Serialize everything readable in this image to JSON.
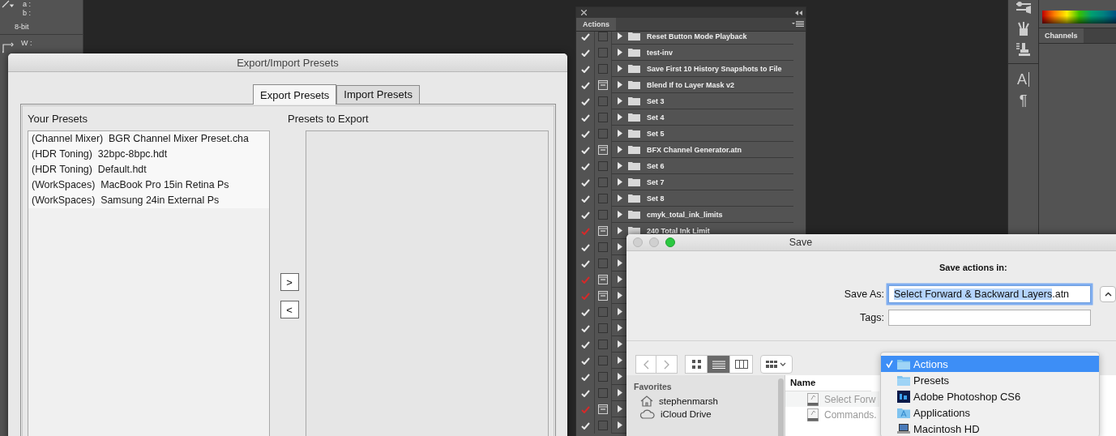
{
  "info_panel": {
    "channel_labels": [
      "a :",
      "b :"
    ],
    "bit_depth": "8-bit",
    "size_labels": [
      "W :"
    ]
  },
  "export_dialog": {
    "title": "Export/Import Presets",
    "tabs": [
      {
        "label": "Export Presets",
        "selected": true
      },
      {
        "label": "Import Presets",
        "selected": false
      }
    ],
    "your_presets": {
      "heading": "Your Presets",
      "items": [
        {
          "label": "(Channel Mixer)  BGR Channel Mixer Preset.cha"
        },
        {
          "label": "(HDR Toning)  32bpc-8bpc.hdt"
        },
        {
          "label": "(HDR Toning)  Default.hdt"
        },
        {
          "label": "(WorkSpaces)  MacBook Pro 15in Retina Ps"
        },
        {
          "label": "(WorkSpaces)  Samsung 24in External Ps"
        }
      ]
    },
    "presets_to_export": {
      "heading": "Presets to Export"
    },
    "buttons": [
      ">",
      "<"
    ]
  },
  "actions_panel": {
    "tab": "Actions",
    "rows": [
      {
        "name": "Reset Button Mode Playback",
        "checked": true,
        "partial": false,
        "dialog": false
      },
      {
        "name": "test-inv",
        "checked": true,
        "partial": false,
        "dialog": false
      },
      {
        "name": "Save First 10 History Snapshots to File",
        "checked": true,
        "partial": false,
        "dialog": false
      },
      {
        "name": "Blend If to Layer Mask v2",
        "checked": true,
        "partial": false,
        "dialog": true
      },
      {
        "name": "Set 3",
        "checked": true,
        "partial": false,
        "dialog": false
      },
      {
        "name": "Set 4",
        "checked": true,
        "partial": false,
        "dialog": false
      },
      {
        "name": "Set 5",
        "checked": true,
        "partial": false,
        "dialog": false
      },
      {
        "name": "BFX Channel Generator.atn",
        "checked": true,
        "partial": false,
        "dialog": true
      },
      {
        "name": "Set 6",
        "checked": true,
        "partial": false,
        "dialog": false
      },
      {
        "name": "Set 7",
        "checked": true,
        "partial": false,
        "dialog": false
      },
      {
        "name": "Set 8",
        "checked": true,
        "partial": false,
        "dialog": false
      },
      {
        "name": "cmyk_total_ink_limits",
        "checked": true,
        "partial": false,
        "dialog": false
      },
      {
        "name": "240 Total Ink Limit",
        "checked": true,
        "partial": true,
        "dialog": true
      },
      {
        "checked": true,
        "partial": false,
        "dialog": false
      },
      {
        "checked": true,
        "partial": false,
        "dialog": false
      },
      {
        "checked": true,
        "partial": true,
        "dialog": true
      },
      {
        "checked": true,
        "partial": true,
        "dialog": true
      },
      {
        "checked": true,
        "partial": false,
        "dialog": false
      },
      {
        "checked": true,
        "partial": false,
        "dialog": false
      },
      {
        "checked": true,
        "partial": false,
        "dialog": false
      },
      {
        "checked": true,
        "partial": false,
        "dialog": false
      },
      {
        "checked": true,
        "partial": false,
        "dialog": false
      },
      {
        "checked": true,
        "partial": false,
        "dialog": false
      },
      {
        "checked": true,
        "partial": true,
        "dialog": true
      },
      {
        "checked": true,
        "partial": false,
        "dialog": false
      }
    ]
  },
  "tool_strip": {
    "type_glyph": "A",
    "paragraph_glyph": "¶"
  },
  "channels_panel": {
    "tab": "Channels"
  },
  "save_dialog": {
    "title": "Save",
    "prompt": "Save actions in:",
    "save_as": {
      "label": "Save As:",
      "selected_text": "Select Forward & Backward Layers",
      "rest_text": ".atn"
    },
    "tags": {
      "label": "Tags:"
    },
    "view_modes": [
      {
        "kind": "icons",
        "selected": false
      },
      {
        "kind": "list",
        "selected": true
      },
      {
        "kind": "columns",
        "selected": false
      }
    ],
    "sidebar": {
      "heading": "Favorites",
      "items": [
        {
          "label": "stephenmarsh",
          "kind": "home"
        },
        {
          "label": "iCloud Drive",
          "kind": "cloud"
        }
      ]
    },
    "files": {
      "column": "Name",
      "rows": [
        {
          "name": "Select Forw",
          "disabled": true
        },
        {
          "name": "Commands.",
          "disabled": true
        }
      ]
    },
    "location_menu": {
      "items": [
        {
          "label": "Actions",
          "kind": "folder",
          "selected": true
        },
        {
          "label": "Presets",
          "kind": "folder",
          "selected": false
        },
        {
          "label": "Adobe Photoshop CS6",
          "kind": "photoshop",
          "selected": false
        },
        {
          "label": "Applications",
          "kind": "applications",
          "selected": false
        },
        {
          "label": "Macintosh HD",
          "kind": "disk",
          "selected": false
        }
      ]
    }
  }
}
